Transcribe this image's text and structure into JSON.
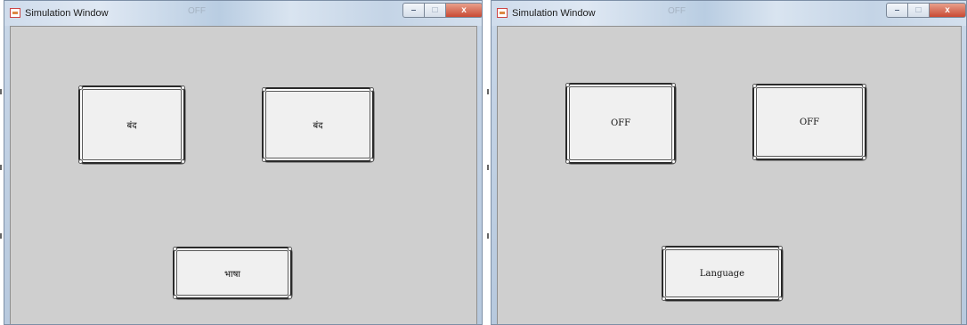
{
  "windows": [
    {
      "title": "Simulation Window",
      "faint_title_text": "OFF",
      "buttons": {
        "left": "बंद",
        "right": "बंद",
        "language": "भाषा"
      },
      "caption": {
        "close": "x"
      }
    },
    {
      "title": "Simulation Window",
      "faint_title_text": "OFF",
      "buttons": {
        "left": "OFF",
        "right": "OFF",
        "language": "Language"
      },
      "caption": {
        "close": "x"
      }
    }
  ]
}
